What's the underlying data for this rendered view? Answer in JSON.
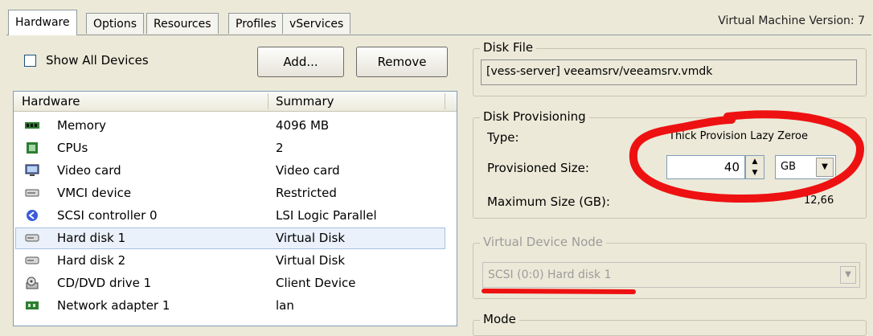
{
  "tabs": [
    {
      "label": "Hardware",
      "active": true
    },
    {
      "label": "Options",
      "active": false
    },
    {
      "label": "Resources",
      "active": false
    },
    {
      "label": "Profiles",
      "active": false
    },
    {
      "label": "vServices",
      "active": false
    }
  ],
  "vm_version": "Virtual Machine Version: 7",
  "left": {
    "show_all_devices": "Show All Devices",
    "add_button": "Add...",
    "remove_button": "Remove",
    "columns": {
      "hardware": "Hardware",
      "summary": "Summary"
    },
    "devices": [
      {
        "name": "Memory",
        "summary": "4096 MB",
        "icon": "memory-icon"
      },
      {
        "name": "CPUs",
        "summary": "2",
        "icon": "cpu-icon"
      },
      {
        "name": "Video card",
        "summary": "Video card",
        "icon": "video-card-icon"
      },
      {
        "name": "VMCI device",
        "summary": "Restricted",
        "icon": "vmci-device-icon"
      },
      {
        "name": "SCSI controller 0",
        "summary": "LSI Logic Parallel",
        "icon": "scsi-controller-icon"
      },
      {
        "name": "Hard disk 1",
        "summary": "Virtual Disk",
        "icon": "hard-disk-icon",
        "selected": true
      },
      {
        "name": "Hard disk 2",
        "summary": "Virtual Disk",
        "icon": "hard-disk-icon"
      },
      {
        "name": "CD/DVD drive 1",
        "summary": "Client Device",
        "icon": "cd-dvd-icon"
      },
      {
        "name": "Network adapter 1",
        "summary": "lan",
        "icon": "network-adapter-icon"
      }
    ]
  },
  "right": {
    "disk_file": {
      "title": "Disk File",
      "value": "[vess-server] veeamsrv/veeamsrv.vmdk"
    },
    "disk_provisioning": {
      "title": "Disk Provisioning",
      "type_label": "Type:",
      "type_value": "Thick Provision Lazy Zeroe",
      "provisioned_label": "Provisioned Size:",
      "provisioned_value": "40",
      "unit": "GB",
      "max_label": "Maximum Size (GB):",
      "max_value": "12,66"
    },
    "virtual_device_node": {
      "title": "Virtual Device Node",
      "value": "SCSI (0:0) Hard disk 1"
    },
    "mode": {
      "title": "Mode"
    }
  },
  "annotation_colors": {
    "red": "#ee1111"
  }
}
